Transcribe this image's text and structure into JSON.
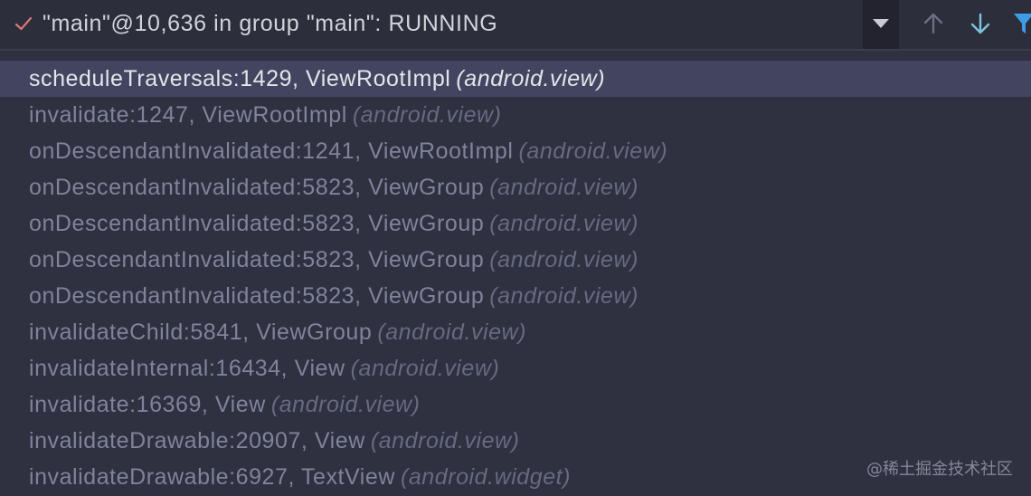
{
  "toolbar": {
    "thread_label": "\"main\"@10,636 in group \"main\": RUNNING",
    "icons": {
      "status": "check-icon",
      "dropdown": "chevron-down-icon",
      "up": "arrow-up-icon",
      "down": "arrow-down-icon",
      "filter": "filter-icon"
    }
  },
  "frames": [
    {
      "method": "scheduleTraversals:1429, ViewRootImpl",
      "package": "(android.view)",
      "selected": true
    },
    {
      "method": "invalidate:1247, ViewRootImpl",
      "package": "(android.view)"
    },
    {
      "method": "onDescendantInvalidated:1241, ViewRootImpl",
      "package": "(android.view)"
    },
    {
      "method": "onDescendantInvalidated:5823, ViewGroup",
      "package": "(android.view)"
    },
    {
      "method": "onDescendantInvalidated:5823, ViewGroup",
      "package": "(android.view)"
    },
    {
      "method": "onDescendantInvalidated:5823, ViewGroup",
      "package": "(android.view)"
    },
    {
      "method": "onDescendantInvalidated:5823, ViewGroup",
      "package": "(android.view)"
    },
    {
      "method": "invalidateChild:5841, ViewGroup",
      "package": "(android.view)"
    },
    {
      "method": "invalidateInternal:16434, View",
      "package": "(android.view)"
    },
    {
      "method": "invalidate:16369, View",
      "package": "(android.view)"
    },
    {
      "method": "invalidateDrawable:20907, View",
      "package": "(android.view)"
    },
    {
      "method": "invalidateDrawable:6927, TextView",
      "package": "(android.widget)"
    }
  ],
  "watermark": "@稀土掘金技术社区",
  "colors": {
    "background": "#2f3040",
    "selected_row": "#434560",
    "check": "#d9787a",
    "arrow_up": "#6c6f82",
    "arrow_down": "#7fc4e0",
    "filter": "#3f9be8"
  }
}
